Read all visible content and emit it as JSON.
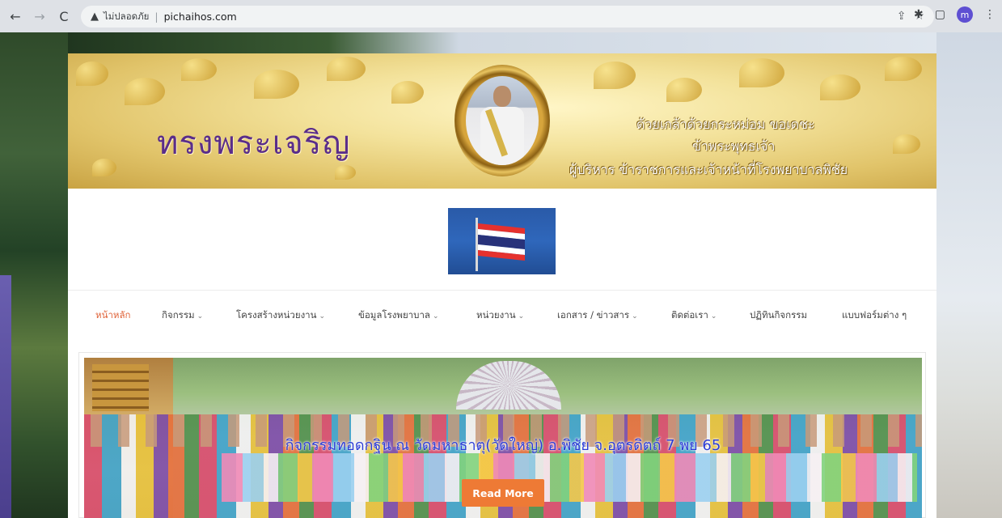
{
  "browser": {
    "back_icon": "←",
    "forward_icon": "→",
    "reload_icon": "C",
    "security_icon": "▲",
    "security_label": "ไม่ปลอดภัย",
    "separator": "|",
    "url": "pichaihos.com",
    "profile_initial": "m"
  },
  "banner": {
    "title": "ทรงพระเจริญ",
    "line1": "ด้วยเกล้าด้วยกระหม่อม ขอเดชะ",
    "line2": "ข้าพระพุทธเจ้า",
    "line3": "ผู้บริหาร ข้าราชการและเจ้าหน้าที่โรงพยาบาลพิชัย"
  },
  "nav": {
    "items": [
      {
        "label": "หน้าหลัก"
      },
      {
        "label": "กิจกรรม"
      },
      {
        "label": "โครงสร้างหน่วยงาน"
      },
      {
        "label": "ข้อมูลโรงพยาบาล"
      },
      {
        "label": "หน่วยงาน"
      },
      {
        "label": "เอกสาร / ข่าวสาร"
      },
      {
        "label": "ติดต่อเรา"
      },
      {
        "label": "ปฏิทินกิจกรรม"
      },
      {
        "label": "แบบฟอร์มต่าง ๆ"
      }
    ],
    "chevron": "⌄"
  },
  "slider": {
    "title": "กิจกรรมทอดกฐิน ณ วัดมหาธาตุ(วัดใหญ่) อ.พิชัย จ.อุตรดิตถ์ 7 พย 65",
    "read_more": "Read More"
  },
  "colors": {
    "accent": "#ee7a35",
    "nav_active": "#e0643a",
    "slide_title": "#2b3bd6"
  }
}
